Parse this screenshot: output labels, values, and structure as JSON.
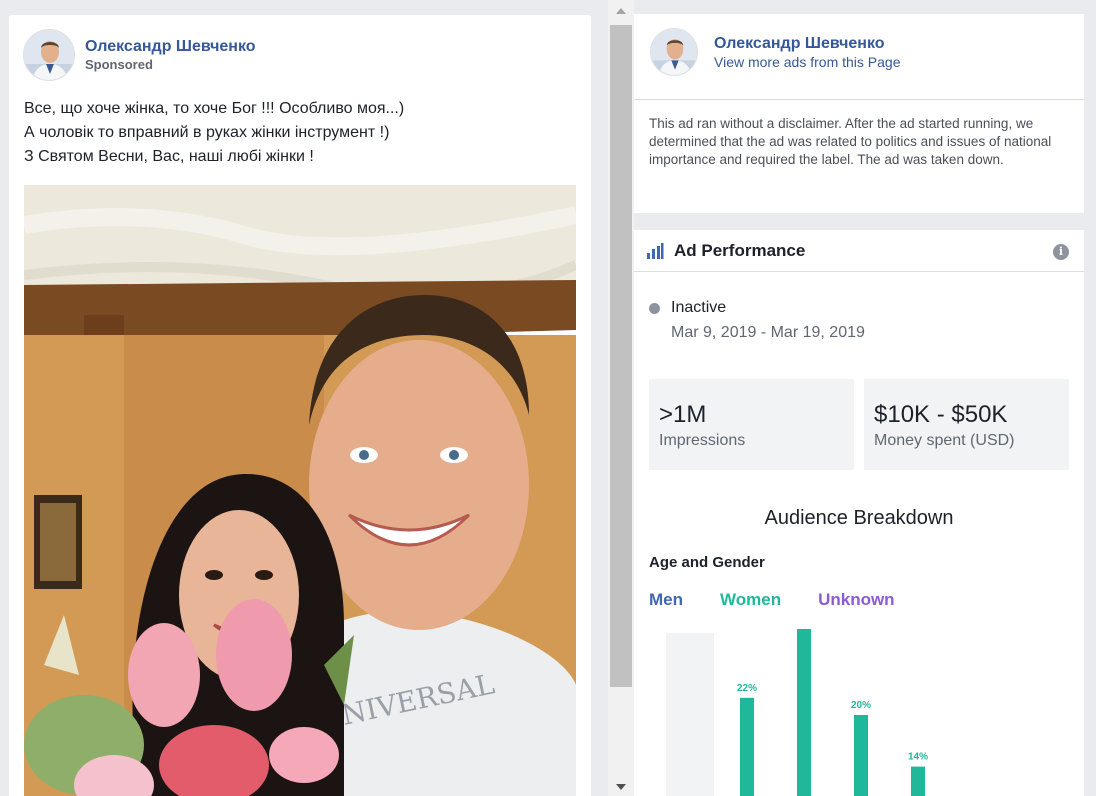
{
  "post": {
    "page_name": "Олександр Шевченко",
    "sponsored": "Sponsored",
    "text_lines": [
      "Все, що хоче жінка, то хоче Бог !!! Особливо моя...)",
      "А чоловік то вправний в руках жінки інструмент !)",
      "З Святом Весни, Вас, наші любі жінки !"
    ]
  },
  "ad_info": {
    "page_name": "Олександр Шевченко",
    "view_more": "View more ads from this Page",
    "disclaimer": "This ad ran without a disclaimer. After the ad started running, we determined that the ad was related to politics and issues of national importance and required the label. The ad was taken down."
  },
  "performance": {
    "title": "Ad Performance",
    "info_glyph": "i",
    "status": "Inactive",
    "date_range": "Mar 9, 2019 - Mar 19, 2019",
    "impressions_value": ">1M",
    "impressions_label": "Impressions",
    "money_value": "$10K - $50K",
    "money_label": "Money spent (USD)",
    "audience_title": "Audience Breakdown",
    "age_gender_label": "Age and Gender",
    "legend": {
      "men": "Men",
      "women": "Women",
      "unknown": "Unknown"
    }
  },
  "colors": {
    "link_blue": "#365899",
    "men": "#4267b2",
    "women": "#20b89a",
    "unknown": "#8c5bd4",
    "status_inactive": "#8d949e"
  },
  "icons": [
    "avatar-photo",
    "bar-chart-icon",
    "info-icon",
    "status-dot"
  ],
  "chart_data": {
    "type": "bar",
    "series": [
      {
        "name": "Women",
        "values": [
          null,
          22,
          30,
          20,
          14
        ]
      }
    ],
    "data_labels": [
      "22%",
      "30%",
      "20%",
      "14%"
    ],
    "ylim": [
      0,
      30
    ]
  }
}
